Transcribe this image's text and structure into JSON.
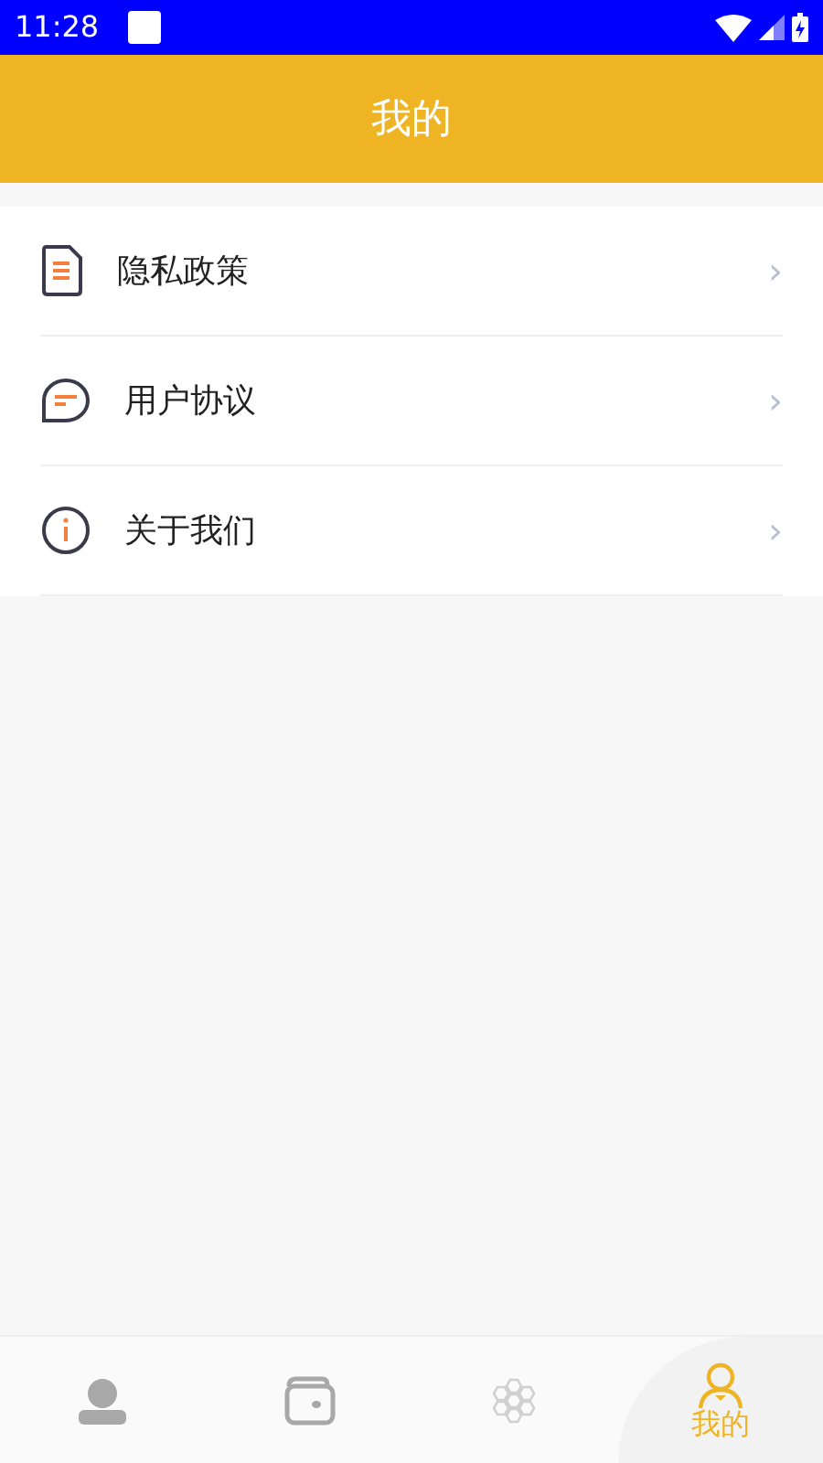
{
  "status_bar": {
    "time": "11:28"
  },
  "header": {
    "title": "我的"
  },
  "menu": [
    {
      "kind": "document",
      "label": "隐私政策",
      "chevron": "›"
    },
    {
      "kind": "chat",
      "label": "用户协议",
      "chevron": "›"
    },
    {
      "kind": "info",
      "label": "关于我们",
      "chevron": "›"
    }
  ],
  "tabs": [
    {
      "kind": "person",
      "selected": false
    },
    {
      "kind": "wallet",
      "selected": false
    },
    {
      "kind": "hexagons",
      "selected": false
    },
    {
      "kind": "user",
      "selected": true,
      "label": "我的"
    }
  ]
}
